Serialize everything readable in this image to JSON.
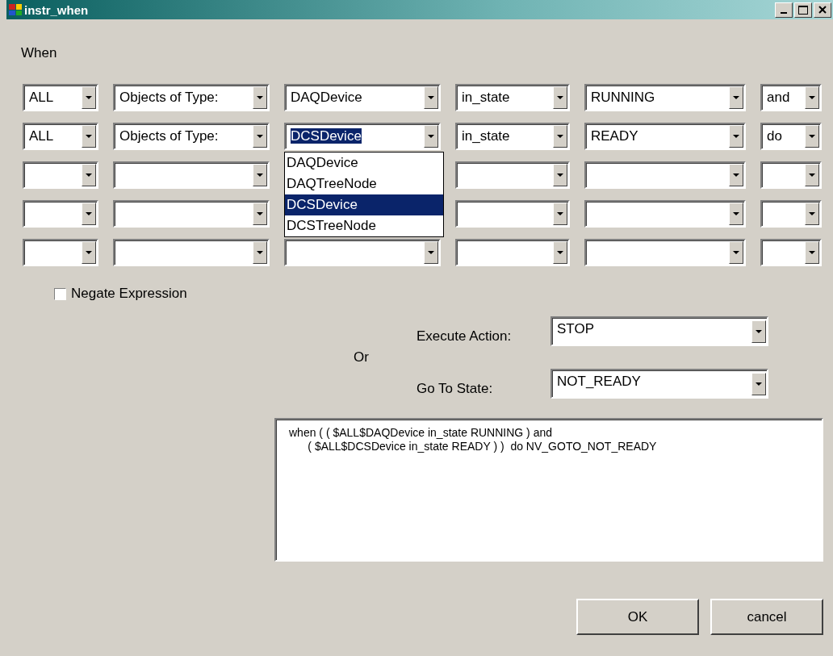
{
  "window": {
    "title": "instr_when"
  },
  "when_label": "When",
  "condition_rows": [
    {
      "cells": [
        {
          "value": "ALL"
        },
        {
          "value": "Objects of Type:"
        },
        {
          "value": "DAQDevice"
        },
        {
          "value": "in_state"
        },
        {
          "value": "RUNNING"
        },
        {
          "value": "and"
        }
      ]
    },
    {
      "cells": [
        {
          "value": "ALL"
        },
        {
          "value": "Objects of Type:"
        },
        {
          "value": "DCSDevice",
          "options": [
            {
              "label": "DAQDevice",
              "selected": false
            },
            {
              "label": "DAQTreeNode",
              "selected": false
            },
            {
              "label": "DCSDevice",
              "selected": true
            },
            {
              "label": "DCSTreeNode",
              "selected": false
            }
          ]
        },
        {
          "value": "in_state"
        },
        {
          "value": "READY"
        },
        {
          "value": "do"
        }
      ]
    },
    {
      "cells": [
        {},
        {},
        null,
        {},
        {},
        {}
      ]
    },
    {
      "cells": [
        {},
        {},
        null,
        {},
        {},
        {}
      ]
    },
    {
      "cells": [
        {},
        {},
        {},
        {},
        {},
        {}
      ]
    }
  ],
  "negate": {
    "label": "Negate Expression",
    "checked": false
  },
  "or_label": "Or",
  "execute_action": {
    "label": "Execute Action:",
    "value": "STOP"
  },
  "go_to_state": {
    "label": "Go To State:",
    "value": "NOT_READY"
  },
  "expression_lines": [
    "when ( ( $ALL$DAQDevice in_state RUNNING ) and",
    "      ( $ALL$DCSDevice in_state READY ) )  do NV_GOTO_NOT_READY"
  ],
  "buttons": [
    "OK",
    "cancel"
  ]
}
